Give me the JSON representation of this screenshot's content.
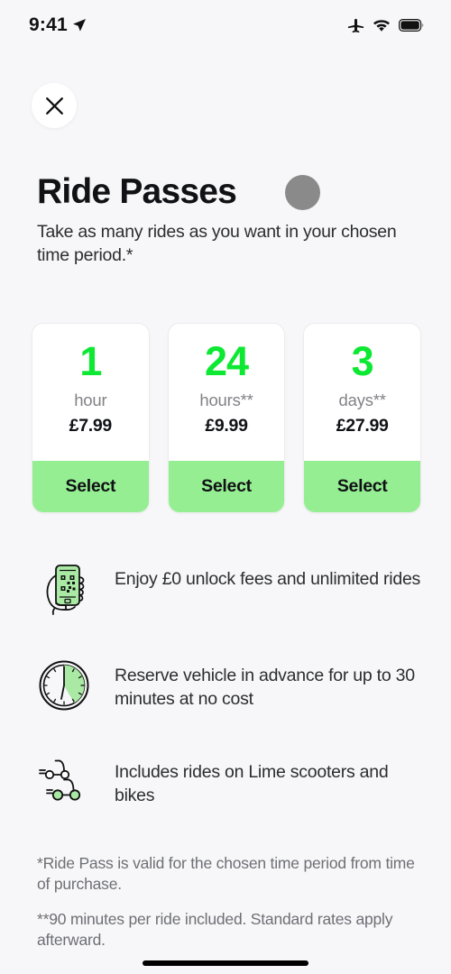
{
  "status_bar": {
    "time": "9:41",
    "icons": [
      "location-arrow-icon",
      "airplane-mode-icon",
      "wifi-icon",
      "battery-icon"
    ]
  },
  "header": {
    "close_label": "close-icon",
    "title": "Ride Passes",
    "subtitle": "Take as many rides as you want in your chosen time period.*",
    "avatar_color": "#8a8a8a"
  },
  "colors": {
    "accent_green": "#0de832",
    "select_green": "#95ee92",
    "background": "#f7f7f9"
  },
  "passes": [
    {
      "amount": "1",
      "unit": "hour",
      "price": "£7.99",
      "select_label": "Select"
    },
    {
      "amount": "24",
      "unit": "hours**",
      "price": "£9.99",
      "select_label": "Select"
    },
    {
      "amount": "3",
      "unit": "days**",
      "price": "£27.99",
      "select_label": "Select"
    }
  ],
  "benefits": [
    {
      "icon": "phone-qr-scan-icon",
      "text": "Enjoy £0 unlock fees and unlimited rides"
    },
    {
      "icon": "clock-reserve-icon",
      "text": "Reserve vehicle in advance for up to 30 minutes at no cost"
    },
    {
      "icon": "scooter-bike-icon",
      "text": "Includes rides on Lime scooters and bikes"
    }
  ],
  "footnotes": [
    "*Ride Pass is valid for the chosen time period from time of purchase.",
    "**90 minutes per ride included. Standard rates apply afterward."
  ]
}
